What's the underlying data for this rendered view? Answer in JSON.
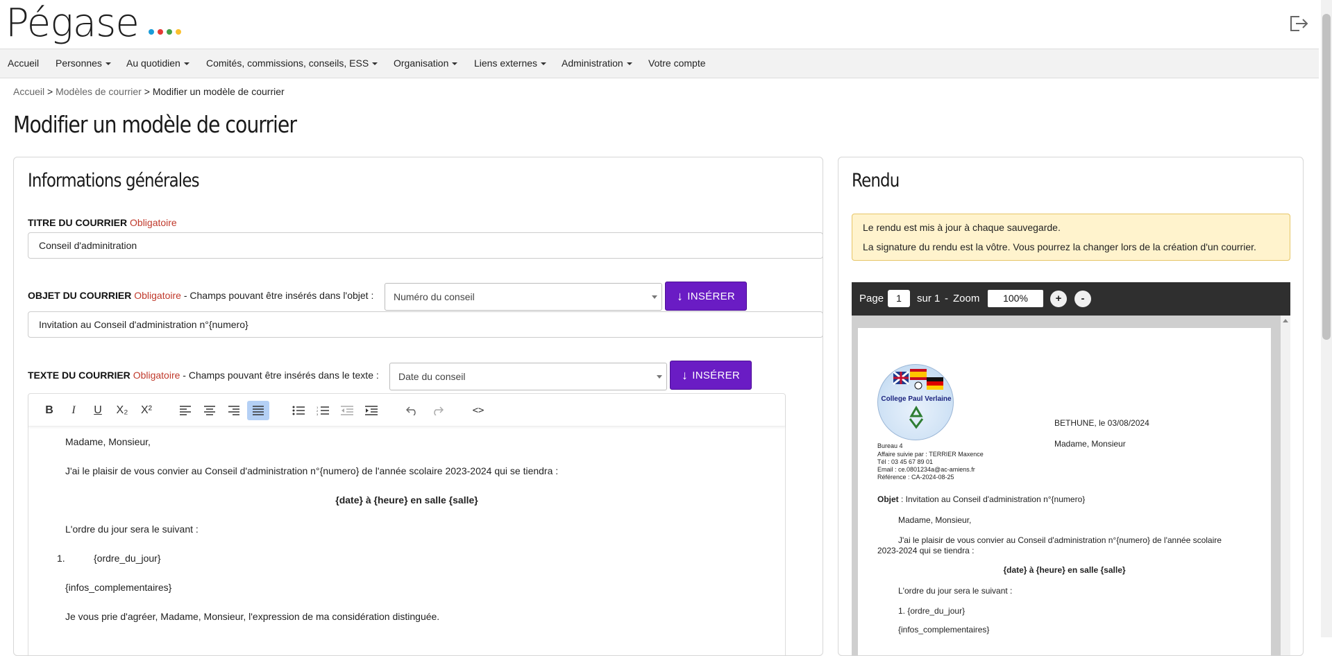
{
  "app": {
    "logo_text": "Pégase",
    "logo_dot_colors": [
      "#1a9cd8",
      "#e53935",
      "#43a047",
      "#fbc02d"
    ]
  },
  "nav": {
    "items": [
      {
        "label": "Accueil",
        "dropdown": false
      },
      {
        "label": "Personnes",
        "dropdown": true
      },
      {
        "label": "Au quotidien",
        "dropdown": true
      },
      {
        "label": "Comités, commissions, conseils, ESS",
        "dropdown": true
      },
      {
        "label": "Organisation",
        "dropdown": true
      },
      {
        "label": "Liens externes",
        "dropdown": true
      },
      {
        "label": "Administration",
        "dropdown": true
      },
      {
        "label": "Votre compte",
        "dropdown": false
      }
    ]
  },
  "breadcrumb": {
    "home": "Accueil",
    "sep": ">",
    "parent": "Modèles de courrier",
    "current": "Modifier un modèle de courrier"
  },
  "page_title": "Modifier un modèle de courrier",
  "left_panel": {
    "title": "Informations générales",
    "titre": {
      "label": "TITRE DU COURRIER",
      "required": "Obligatoire",
      "value": "Conseil d'adminitration"
    },
    "objet": {
      "label": "OBJET DU COURRIER",
      "required": "Obligatoire",
      "hint": " - Champs pouvant être insérés dans l'objet :",
      "select_value": "Numéro du conseil",
      "button": "INSÉRER",
      "value": "Invitation au Conseil d'administration n°{numero}"
    },
    "texte": {
      "label": "TEXTE DU COURRIER",
      "required": "Obligatoire",
      "hint": " - Champs pouvant être insérés dans le texte :",
      "select_value": "Date du conseil",
      "button": "INSÉRER"
    },
    "toolbar_labels": {
      "bold": "B",
      "italic": "I",
      "underline": "U",
      "subscript": "X₂",
      "superscript": "X²",
      "source": "<>"
    },
    "editor_lines": {
      "greeting": "Madame, Monsieur,",
      "p1": "J'ai le plaisir de vous convier au Conseil d'administration n°{numero} de l'année scolaire 2023-2024 qui se tiendra :",
      "p2": "{date} à {heure} en salle {salle}",
      "p3": "L'ordre du jour sera le suivant :",
      "list_num": "1.",
      "list_item": "{ordre_du_jour}",
      "p4": "{infos_complementaires}",
      "p5": "Je vous prie d'agréer, Madame, Monsieur, l'expression de ma considération distinguée."
    }
  },
  "right_panel": {
    "title": "Rendu",
    "notice_line1": "Le rendu est mis à jour à chaque sauvegarde.",
    "notice_line2": "La signature du rendu est la vôtre. Vous pourrez la changer lors de la création d'un courrier.",
    "pdf": {
      "page_label": "Page",
      "page_value": "1",
      "of_label": "sur 1",
      "dash": "-",
      "zoom_label": "Zoom",
      "zoom_value": "100%",
      "zoom_in": "+",
      "zoom_out": "-"
    },
    "document": {
      "school_name": "College Paul Verlaine",
      "city_date": "BETHUNE, le 03/08/2024",
      "recipient": "Madame, Monsieur",
      "bureau": "Bureau 4",
      "suivie": "Affaire suivie par : TERRIER Maxence",
      "tel": "Tél : 03 45 67 89 01",
      "email": "Email : ce.0801234a@ac-amiens.fr",
      "reference": "Référence : CA-2024-08-25",
      "objet_label": "Objet",
      "objet_text": " : Invitation au Conseil d'administration n°{numero}",
      "greeting": "Madame, Monsieur,",
      "p1a": "J'ai le plaisir de vous convier au Conseil d'administration n°{numero} de l'année scolaire",
      "p1b": "2023-2024 qui se tiendra :",
      "p2": "{date} à {heure} en salle {salle}",
      "p3": "L'ordre du jour sera le suivant :",
      "list_item": "1. {ordre_du_jour}",
      "p4": "{infos_complementaires}"
    }
  }
}
